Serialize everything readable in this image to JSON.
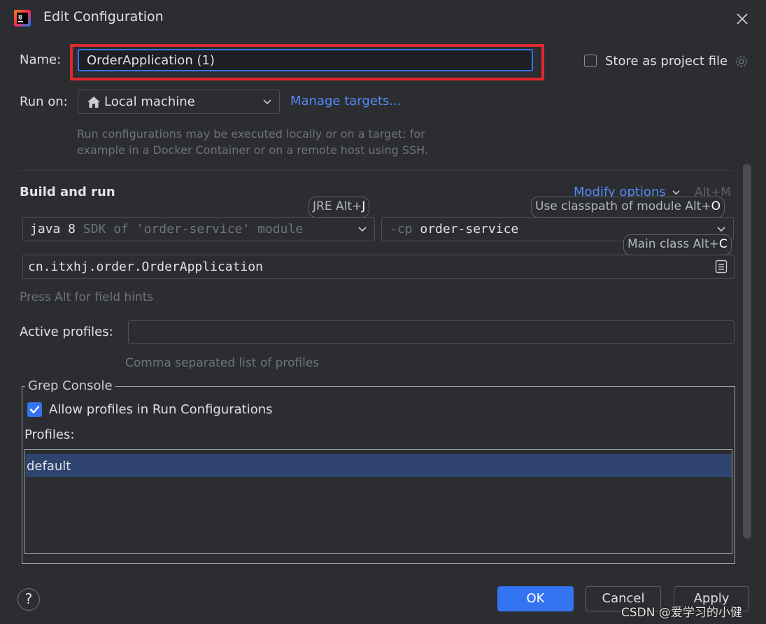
{
  "window": {
    "title": "Edit Configuration"
  },
  "name_row": {
    "label": "Name:",
    "value": "OrderApplication (1)"
  },
  "store_project": {
    "label": "Store as project file",
    "checked": false
  },
  "run_on": {
    "label": "Run on:",
    "value": "Local machine",
    "manage_link": "Manage targets...",
    "hint_line1": "Run configurations may be executed locally or on a target: for",
    "hint_line2": "example in a Docker Container or on a remote host using SSH."
  },
  "build_run": {
    "title": "Build and run",
    "modify_options": "Modify options",
    "modify_shortcut": "Alt+M",
    "jre_hint_text": "JRE Alt+",
    "jre_hint_key": "J",
    "classpath_hint_text": "Use classpath of module Alt+",
    "classpath_hint_key": "O",
    "sdk_main": "java 8",
    "sdk_detail": "SDK of 'order-service' module",
    "cp_flag": "-cp",
    "cp_module": "order-service",
    "main_class_hint_text": "Main class Alt+",
    "main_class_hint_key": "C",
    "main_class": "cn.itxhj.order.OrderApplication",
    "field_hints": "Press Alt for field hints"
  },
  "active_profiles": {
    "label": "Active profiles:",
    "value": "",
    "hint": "Comma separated list of profiles"
  },
  "grep_console": {
    "title": "Grep Console",
    "allow_label": "Allow profiles in Run Configurations",
    "allow_checked": true,
    "profiles_label": "Profiles:",
    "profiles": [
      "default"
    ]
  },
  "footer": {
    "help": "?",
    "ok": "OK",
    "cancel": "Cancel",
    "apply": "Apply"
  },
  "watermark": "CSDN @爱学习的小健",
  "colors": {
    "background": "#2b2d30",
    "accent": "#3574f0",
    "link": "#548af7",
    "highlight_border": "#e0282e",
    "selection": "#2e436e"
  }
}
